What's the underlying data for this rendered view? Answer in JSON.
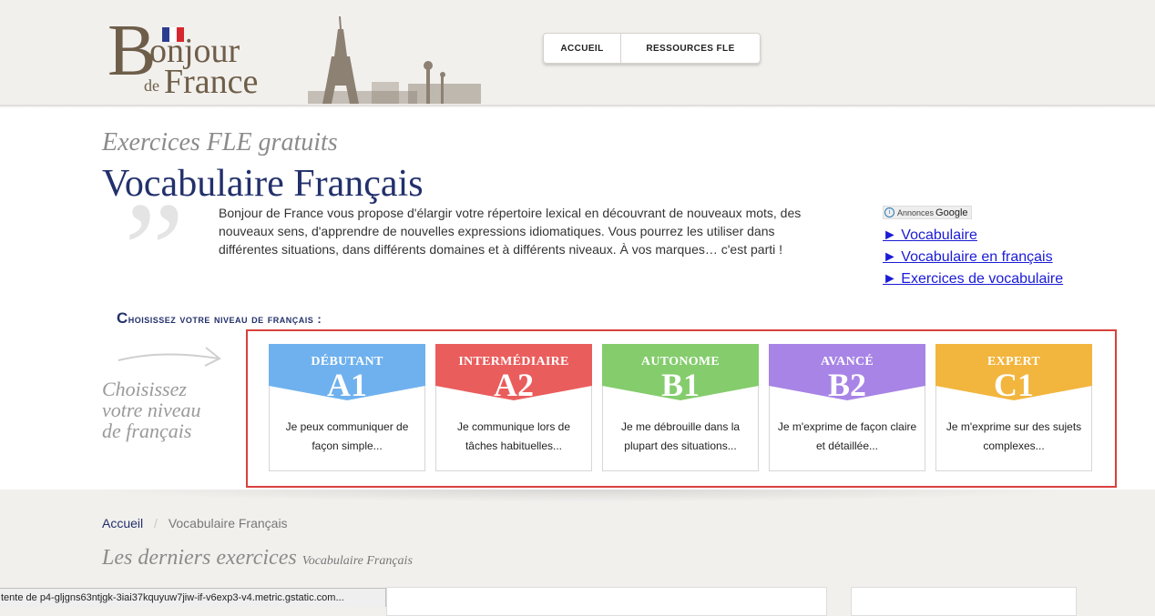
{
  "header": {
    "logo": {
      "b": "B",
      "onjour": "onjour",
      "de": "de",
      "france": "France"
    },
    "nav": [
      {
        "label": "ACCUEIL"
      },
      {
        "label": "RESSOURCES FLE"
      }
    ]
  },
  "hero": {
    "subtitle": "Exercices FLE gratuits",
    "title": "Vocabulaire Français",
    "quote_mark": "”",
    "intro": "Bonjour de France vous propose d'élargir votre répertoire lexical en découvrant de nouveaux mots, des nouveaux sens, d'apprendre de nouvelles expressions idiomatiques. Vous pourrez les utiliser dans différentes situations, dans différents domaines et à différents niveaux. À vos marques… c'est parti !"
  },
  "ads": {
    "badge": "Annonces",
    "badge_brand": "Google",
    "links": [
      "► Vocabulaire",
      "► Vocabulaire en français",
      "► Exercices de vocabulaire"
    ]
  },
  "levels": {
    "heading_cap": "C",
    "heading_rest": "hoisissez votre niveau de français :",
    "side_text": [
      "Choisissez",
      "votre niveau",
      "de français"
    ],
    "cards": [
      {
        "name": "DÉBUTANT",
        "code": "A1",
        "desc": "Je peux communiquer de façon simple...",
        "color": "#6fb1ee"
      },
      {
        "name": "INTERMÉDIAIRE",
        "code": "A2",
        "desc": "Je communique lors de tâches habituelles...",
        "color": "#ea5d5d"
      },
      {
        "name": "AUTONOME",
        "code": "B1",
        "desc": "Je me débrouille dans la plupart des situations...",
        "color": "#84cc6c"
      },
      {
        "name": "AVANCÉ",
        "code": "B2",
        "desc": "Je m'exprime de façon claire et détaillée...",
        "color": "#a884e6"
      },
      {
        "name": "EXPERT",
        "code": "C1",
        "desc": "Je m'exprime sur des sujets complexes...",
        "color": "#f2b53e"
      }
    ]
  },
  "breadcrumb": {
    "home": "Accueil",
    "separator": "/",
    "current": "Vocabulaire Français"
  },
  "latest": {
    "title": "Les derniers exercices",
    "sub": "Vocabulaire Français"
  },
  "status_bar": "tente de p4-gljgns63ntjgk-3iai37kquyuw7jiw-if-v6exp3-v4.metric.gstatic.com...",
  "colors": {
    "brand_blue": "#22306b",
    "frame_red": "#d9403d",
    "logo_brown": "#6e5e49"
  }
}
